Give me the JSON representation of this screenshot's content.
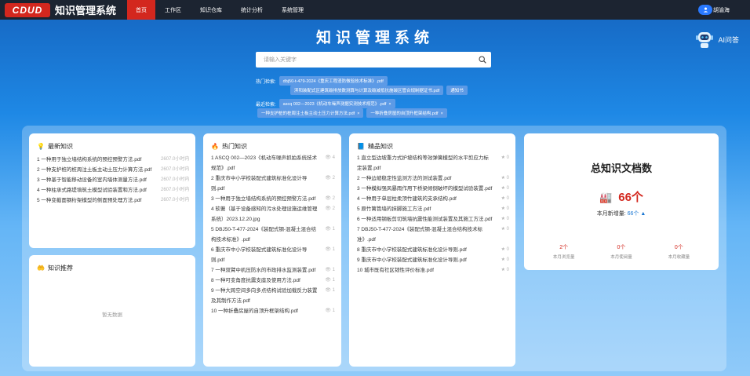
{
  "header": {
    "logo": "CDUD",
    "title": "知识管理系统",
    "nav": [
      "首页",
      "工作区",
      "知识仓库",
      "统计分析",
      "系统管理"
    ],
    "user": "胡渝海"
  },
  "hero": {
    "title": "知识管理系统",
    "ai_label": "AI问答",
    "search_placeholder": "请输入关键字"
  },
  "hot_search": {
    "label": "热门检索:",
    "tags_line1": [
      "dbj50-t-479-2024《重庆工程渣防做验技术标准》.pdf"
    ],
    "tags_line2": [
      "滨阳装配式区建筑碳排放数测算与计算及碳减抵抗施碳区管合规制据证书.pdf",
      "通知书"
    ]
  },
  "recent_search": {
    "label": "最近检索:",
    "tags_line1": [
      "ascq 002—2023《机动车噪声测据实测技术规范》.pdf"
    ],
    "tags_line2": [
      "一种支护桩的桩周注土板主动土压力计算方法.pdf",
      "一种折叠房屋的自顶升框架结构.pdf"
    ]
  },
  "latest": {
    "title": "最新知识",
    "items": [
      {
        "t": "1 一种用于独立墙结构系统的预控预警方法.pdf",
        "m": "2607.0小时内"
      },
      {
        "t": "2 一种支护桩的桩周注土板主动土压力计算方法.pdf",
        "m": "2607.0小时内"
      },
      {
        "t": "3 一种基于智能移动设备的室内墙体测量方法.pdf",
        "m": "2607.0小时内"
      },
      {
        "t": "4 一种柱承式路堤填筑土模型试验装置和方法.pdf",
        "m": "2607.0小时内"
      },
      {
        "t": "5 一种变截面钢桁架模型的侧面预处理方法.pdf",
        "m": "2607.0小时内"
      }
    ]
  },
  "recommend": {
    "title": "知识推荐",
    "empty": "暂无数据"
  },
  "hot": {
    "title": "热门知识",
    "items": [
      {
        "t": "1 ASCQ 002—2023《机动车噪声抓拍系统技术规范》.pdf",
        "m": "4"
      },
      {
        "t": "2 重庆市中小学校装配式建筑标准化设计导则.pdf",
        "m": "2"
      },
      {
        "t": "3 一种用于独立墙结构系统的预控预警方法.pdf",
        "m": "2"
      },
      {
        "t": "4 软著（基于设备感知的污水处理设施运维管理系统）2023.12.20.jpg",
        "m": "2"
      },
      {
        "t": "5 DBJ50-T-477-2024《装配式钢-混凝土混合结构技术标准》.pdf",
        "m": "1"
      },
      {
        "t": "6 重庆市中小学校装配式建筑标准化设计导则.pdf",
        "m": "1"
      },
      {
        "t": "7 一种双臂中机压防水的市政排水监测装置.pdf",
        "m": "1"
      },
      {
        "t": "8 一种可变角度抗震支座及使用方法.pdf",
        "m": "1"
      },
      {
        "t": "9 一种大跨空间多向多点结构试验加载反力装置及其制作方法.pdf",
        "m": "1"
      },
      {
        "t": "10 一种折叠房屋的自顶升框架结构.pdf",
        "m": "1"
      }
    ]
  },
  "featured": {
    "title": "精品知识",
    "items": [
      {
        "t": "1 直立型边坡重力式护坡结构等效弹簧模型的水平剪应力标定装置.pdf",
        "m": "0"
      },
      {
        "t": "2 一种边坡稳定性监测方法的测试装置.pdf",
        "m": "0"
      },
      {
        "t": "3 一种模拟强风暴雨作用下桥梁倾倒破坏的模型试验装置.pdf",
        "m": "0"
      },
      {
        "t": "4 一种用于单层柱柔顶竹建筑的支承结构.pdf",
        "m": "0"
      },
      {
        "t": "5 原竹篱笆墙的抹脚施工方法.pdf",
        "m": "0"
      },
      {
        "t": "6 一种适用钢板剪切筑墙抗震性能测试装置及其施工方法.pdf",
        "m": "0"
      },
      {
        "t": "7 DBJ50-T-477-2024《装配式钢-混凝土混合结构技术标准》.pdf",
        "m": "0"
      },
      {
        "t": "8 重庆市中小学校装配式建筑标准化设计导则.pdf",
        "m": "0"
      },
      {
        "t": "9 重庆市中小学校装配式建筑标准化设计导则.pdf",
        "m": "0"
      },
      {
        "t": "10 城市既有社区韧性评价标准.pdf",
        "m": "0"
      }
    ]
  },
  "total": {
    "title": "总知识文档数",
    "count": "66个",
    "month_label": "本月新增量:",
    "month_value": "66个 ▲",
    "stats": [
      {
        "v": "2个",
        "l": "本月浏览量"
      },
      {
        "v": "0个",
        "l": "本月使阅量"
      },
      {
        "v": "0个",
        "l": "本月收藏量"
      }
    ]
  },
  "colors": {
    "brand_red": "#d3271e",
    "nav_bg": "#1c2431",
    "tag_bg": "#5c9ae6",
    "link_blue": "#1976d2"
  }
}
